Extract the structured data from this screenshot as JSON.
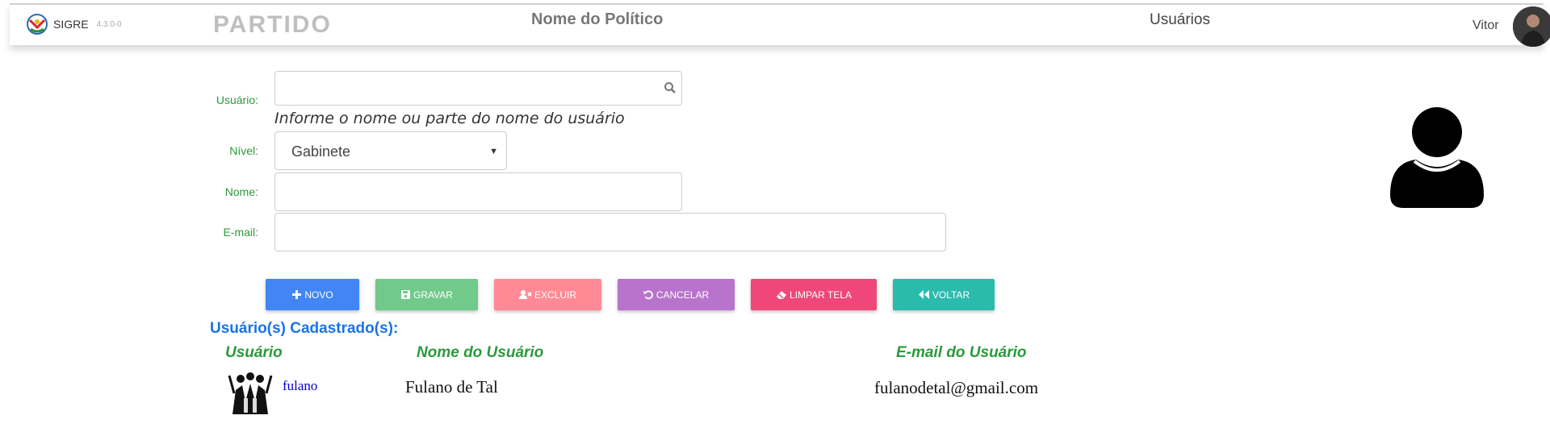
{
  "header": {
    "app_name": "SIGRE",
    "version": "4.3.0-0",
    "party_logo_text": "PARTIDO",
    "politician": "Nome do Político",
    "section": "Usuários",
    "user": "Vitor"
  },
  "form": {
    "usuario_label": "Usuário:",
    "usuario_value": "",
    "usuario_hint": "Informe o nome ou parte do nome do usuário",
    "nivel_label": "Nível:",
    "nivel_value": "Gabinete",
    "nome_label": "Nome:",
    "nome_value": "",
    "email_label": "E-mail:",
    "email_value": ""
  },
  "buttons": {
    "novo": {
      "label": "NOVO",
      "color": "#4285f4",
      "icon": "plus-icon"
    },
    "gravar": {
      "label": "GRAVAR",
      "color": "#71c98a",
      "icon": "save-icon"
    },
    "excluir": {
      "label": "EXCLUIR",
      "color": "#ff8a95",
      "icon": "user-remove-icon"
    },
    "cancelar": {
      "label": "CANCELAR",
      "color": "#b874cc",
      "icon": "undo-icon"
    },
    "limpar": {
      "label": "LIMPAR TELA",
      "color": "#ef4777",
      "icon": "eraser-icon"
    },
    "voltar": {
      "label": "VOLTAR",
      "color": "#2bbbad",
      "icon": "backward-icon"
    }
  },
  "list": {
    "title": "Usuário(s) Cadastrado(s):",
    "columns": [
      "Usuário",
      "Nome do Usuário",
      "E-mail do Usuário"
    ],
    "rows": [
      {
        "username": "fulano",
        "name": "Fulano de Tal",
        "email": "fulanodetal@gmail.com"
      }
    ]
  },
  "colors": {
    "label_green": "#2a9a3a",
    "title_blue": "#1a73e8"
  }
}
